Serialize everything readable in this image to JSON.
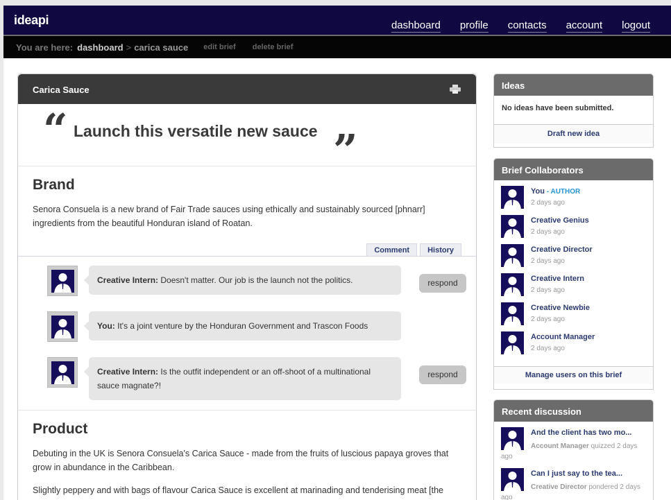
{
  "app": {
    "name": "ideapi"
  },
  "nav": [
    "dashboard",
    "profile",
    "contacts",
    "account",
    "logout"
  ],
  "breadcrumb": {
    "label": "You are here:",
    "items": [
      "dashboard",
      "carica sauce"
    ],
    "separator": ">",
    "actions": [
      "edit brief",
      "delete brief"
    ]
  },
  "brief": {
    "title": "Carica Sauce",
    "quote": "Launch this versatile new sauce",
    "sections": [
      {
        "heading": "Brand",
        "body": "Senora Consuela is a new brand of Fair Trade sauces using ethically and sustainably sourced [phnarr] ingredients from the beautiful Honduran island of Roatan."
      },
      {
        "heading": "Product",
        "body": "Debuting in the UK is Senora Consuela's Carica Sauce - made from the fruits of luscious papaya groves that grow in abundance in the Caribbean.",
        "body2": "Slightly peppery and with bags of flavour Carica Sauce is excellent at marinading and tenderising meat [the naturally occurring papain enzyme in the fruit is used in most meat tenderising products] but is also a"
      }
    ],
    "tabs": [
      "Comment",
      "History"
    ],
    "comments": [
      {
        "author": "Creative Intern:",
        "text": " Doesn't matter. Our job is the launch not the politics.",
        "action": "respond"
      },
      {
        "author": "You:",
        "text": " It's a joint venture by the Honduran Government and Trascon Foods",
        "action": ""
      },
      {
        "author": "Creative Intern:",
        "text": " Is the outfit independent or an off-shoot of a multinational sauce magnate?!",
        "action": "respond"
      }
    ]
  },
  "ideas": {
    "title": "Ideas",
    "message": "No ideas have been submitted.",
    "link": "Draft new idea"
  },
  "collaborators": {
    "title": "Brief Collaborators",
    "items": [
      {
        "name": "You",
        "role": " - AUTHOR",
        "time": "2 days ago"
      },
      {
        "name": "Creative Genius",
        "role": "",
        "time": "2 days ago"
      },
      {
        "name": "Creative Director",
        "role": "",
        "time": "2 days ago"
      },
      {
        "name": "Creative Intern",
        "role": "",
        "time": "2 days ago"
      },
      {
        "name": "Creative Newbie",
        "role": "",
        "time": "2 days ago"
      },
      {
        "name": "Account Manager",
        "role": "",
        "time": "2 days ago"
      }
    ],
    "link": "Manage users on this brief"
  },
  "recent": {
    "title": "Recent discussion",
    "items": [
      {
        "title": "And the client has two mo...",
        "who": "Account Manager",
        "verb": " quizzed 2 days ago"
      },
      {
        "title": "Can I just say to the tea...",
        "who": "Creative Director",
        "verb": " pondered 2 days ago"
      }
    ]
  },
  "colors": {
    "topbar": "#0f0841",
    "panel_header": "#3a3a3a",
    "side_header": "#6b6b6b",
    "link": "#2b3a70",
    "role": "#2795d6"
  }
}
